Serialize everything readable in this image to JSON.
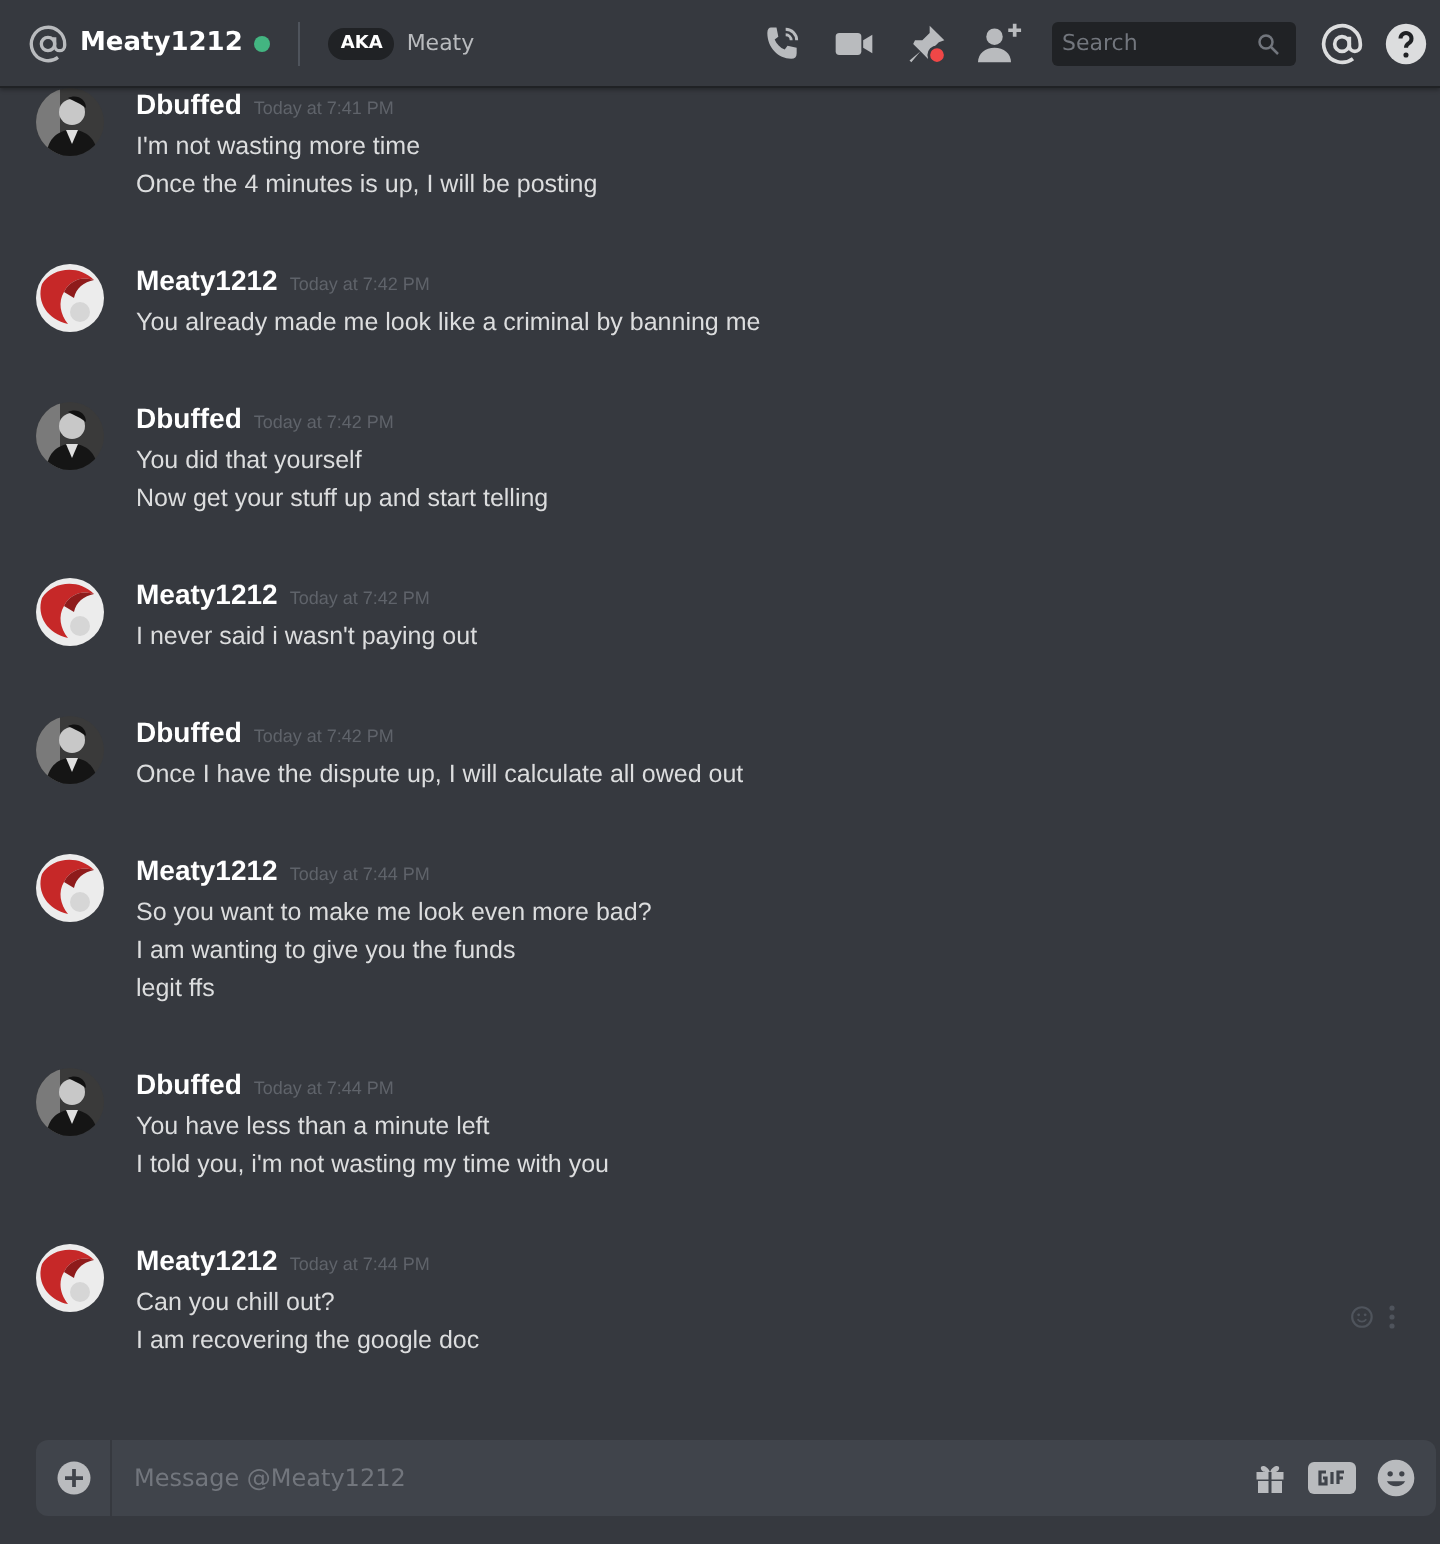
{
  "channel": {
    "name": "Meaty1212",
    "online": true,
    "aka_label": "AKA",
    "aka_name": "Meaty"
  },
  "search": {
    "placeholder": "Search"
  },
  "pins_unread": true,
  "messages": [
    {
      "author": "Dbuffed",
      "avatar": {
        "kind": "portrait"
      },
      "time": "Today at 7:41 PM",
      "hovered": false,
      "lines": [
        "I'm not wasting more time",
        "Once the 4 minutes is up, I will be posting"
      ]
    },
    {
      "author": "Meaty1212",
      "avatar": {
        "kind": "ball"
      },
      "time": "Today at 7:42 PM",
      "hovered": false,
      "lines": [
        "You already made me look like a criminal by banning me"
      ]
    },
    {
      "author": "Dbuffed",
      "avatar": {
        "kind": "portrait"
      },
      "time": "Today at 7:42 PM",
      "hovered": false,
      "lines": [
        "You did that yourself",
        "Now get your stuff up and start telling"
      ]
    },
    {
      "author": "Meaty1212",
      "avatar": {
        "kind": "ball"
      },
      "time": "Today at 7:42 PM",
      "hovered": false,
      "lines": [
        "I never said i wasn't paying out"
      ]
    },
    {
      "author": "Dbuffed",
      "avatar": {
        "kind": "portrait"
      },
      "time": "Today at 7:42 PM",
      "hovered": false,
      "lines": [
        "Once I have the dispute up, I will calculate all owed out"
      ]
    },
    {
      "author": "Meaty1212",
      "avatar": {
        "kind": "ball"
      },
      "time": "Today at 7:44 PM",
      "hovered": false,
      "lines": [
        "So you want to make me look even more bad?",
        "I am wanting to give you the funds",
        "legit ffs"
      ]
    },
    {
      "author": "Dbuffed",
      "avatar": {
        "kind": "portrait"
      },
      "time": "Today at 7:44 PM",
      "hovered": false,
      "lines": [
        "You have less than a minute left",
        "I told you, i'm not wasting my time with you"
      ]
    },
    {
      "author": "Meaty1212",
      "avatar": {
        "kind": "ball"
      },
      "time": "Today at 7:44 PM",
      "hovered": true,
      "lines": [
        "Can you chill out?",
        "I am recovering the google doc"
      ]
    }
  ],
  "composer": {
    "placeholder": "Message @Meaty1212"
  }
}
